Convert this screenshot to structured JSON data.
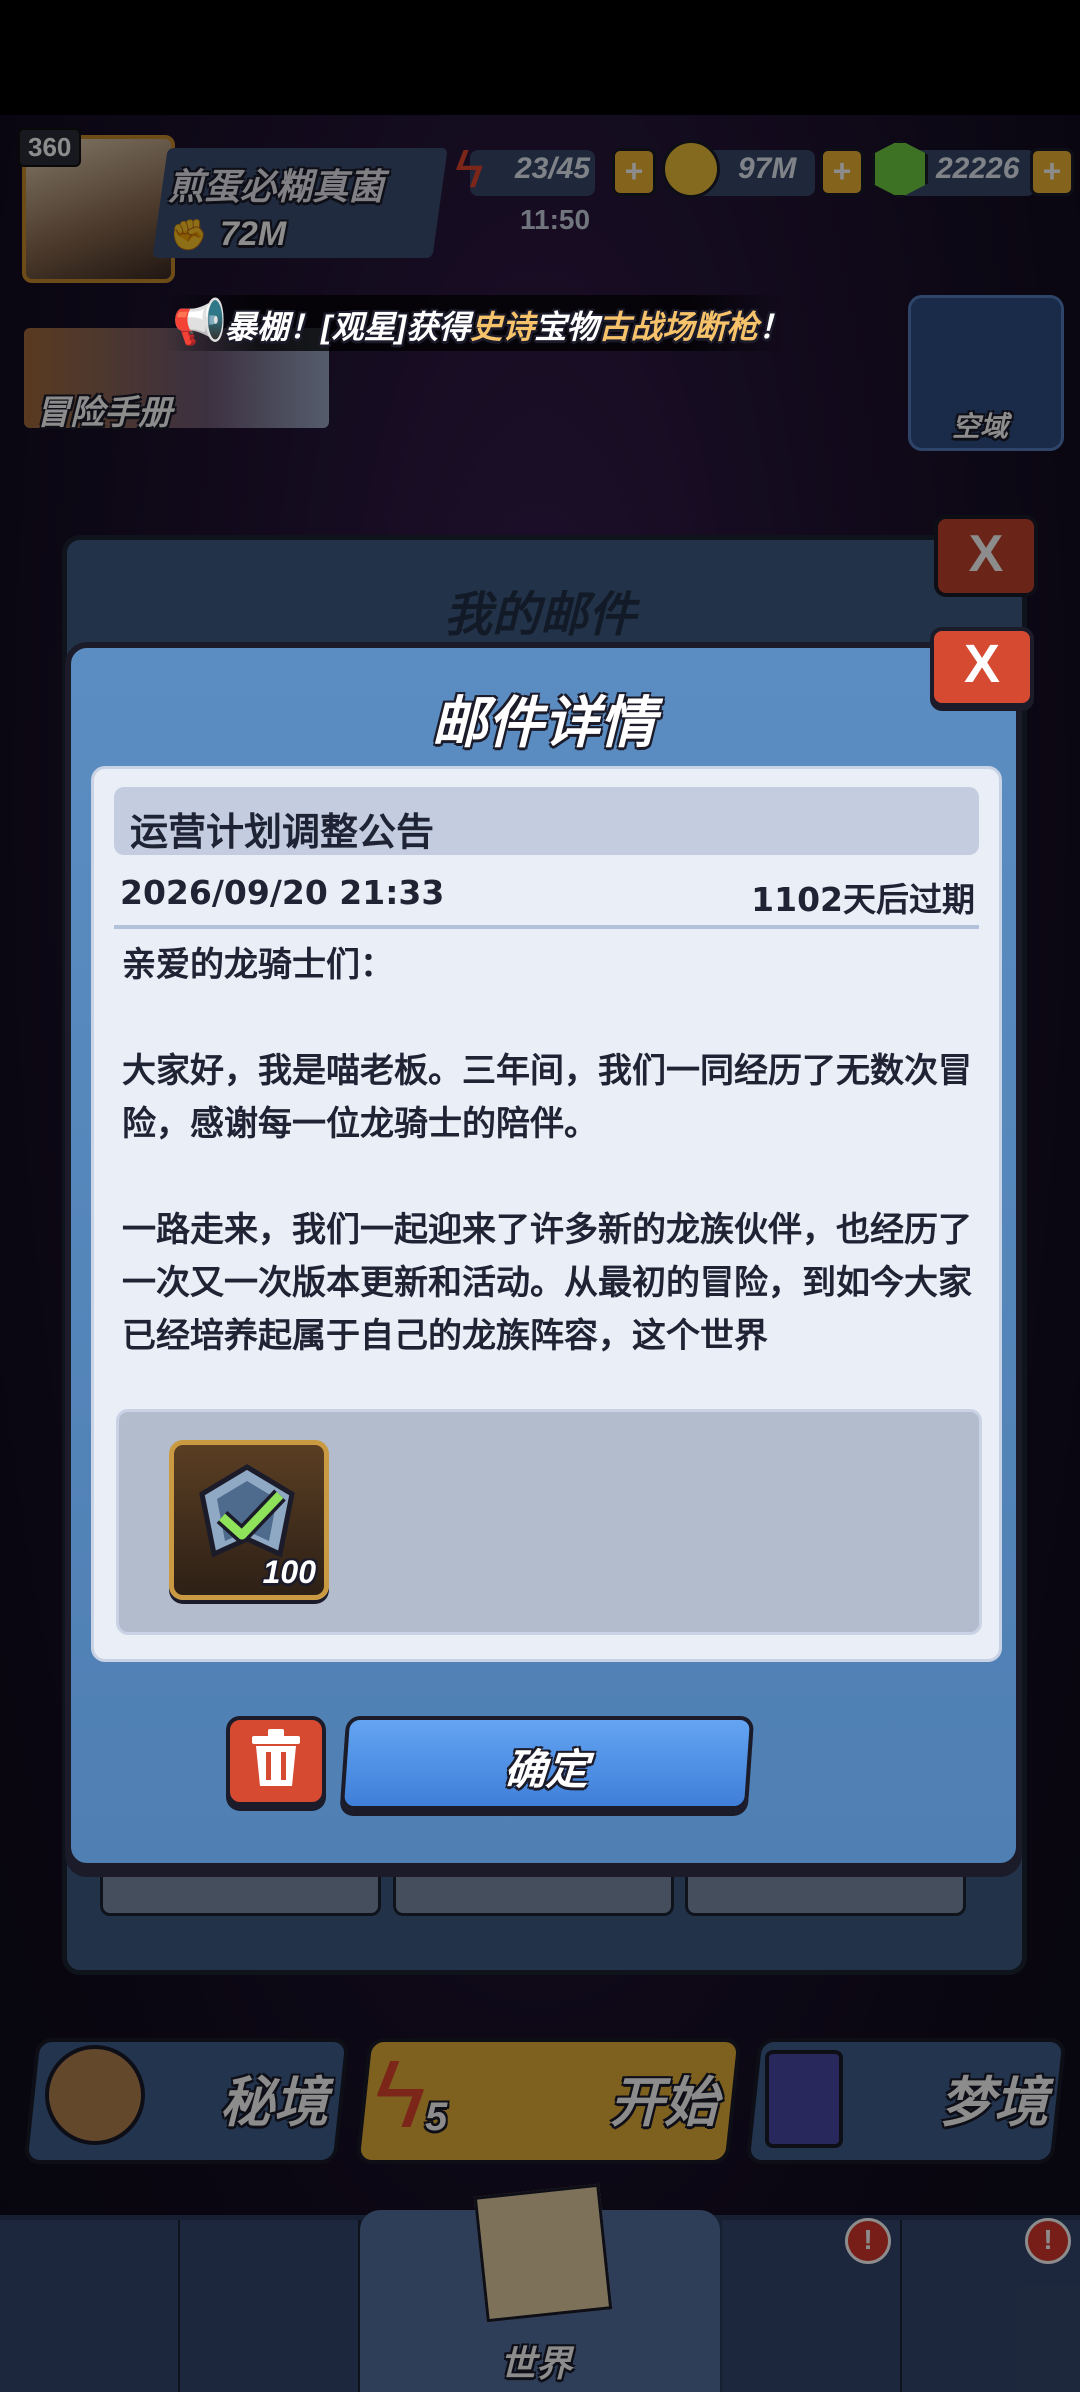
{
  "hud": {
    "level": "360",
    "player_name": "煎蛋必糊真菌",
    "power": "72M",
    "energy": "23/45",
    "energy_timer": "11:50",
    "gold": "97M",
    "gems": "22226",
    "plus": "+"
  },
  "broadcast": {
    "prefix": "暴棚！[观星]获得",
    "rarity": "史诗",
    "middle": "宝物",
    "item": "古战场断枪",
    "suffix": "！"
  },
  "side": {
    "adventure_manual": "冒险手册",
    "sky_zone": "空域"
  },
  "mail_window": {
    "title": "我的邮件",
    "close": "X"
  },
  "mail_detail": {
    "title": "邮件详情",
    "close": "X",
    "subject": "运营计划调整公告",
    "date": "2026/09/20 21:33",
    "expire": "1102天后过期",
    "paragraphs": [
      "亲爱的龙骑士们：",
      "大家好，我是喵老板。三年间，我们一同经历了无数次冒险，感谢每一位龙骑士的陪伴。",
      "一路走来，我们一起迎来了许多新的龙族伙伴，也经历了一次又一次版本更新和活动。从最初的冒险，到如今大家已经培养起属于自己的龙族阵容，这个世界"
    ],
    "attachment": {
      "icon": "silver-check-crest-icon",
      "quantity": "100"
    },
    "confirm_label": "确定"
  },
  "actions": {
    "secret": "秘境",
    "start": "开始",
    "start_cost": "5",
    "dream": "梦境"
  },
  "nav": {
    "world": "世界",
    "badge": "!"
  }
}
